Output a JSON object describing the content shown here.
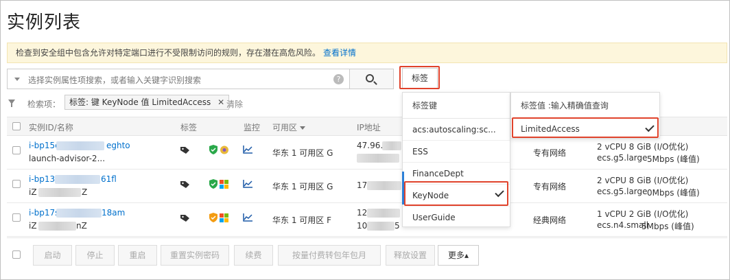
{
  "page": {
    "title": "实例列表",
    "warning_text": "检查到安全组中包含允许对特定端口进行不受限制访问的规则，存在潜在高危风险。",
    "warning_link": "查看详情"
  },
  "search": {
    "placeholder": "选择实例属性项搜索，或者输入关键字识别搜索",
    "help": "?",
    "tag_button": "标签"
  },
  "filter": {
    "label": "检索项：",
    "chip": "标签: 键 KeyNode 值 LimitedAccess",
    "chip_close": "✕",
    "clear": "清除"
  },
  "table": {
    "headers": {
      "id": "实例ID/名称",
      "tags": "标签",
      "monitor": "监控",
      "zone": "可用区",
      "ip": "IP地址"
    },
    "rows": [
      {
        "id_prefix": "i-bp15e",
        "id_suffix": "eghto",
        "name": "launch-advisor-2...",
        "zone": "华东 1 可用区 G",
        "ip": "47.96.",
        "network": "专有网络",
        "spec1": "2 vCPU 8 GiB (I/O优化)",
        "spec2": "ecs.g5.large",
        "bandwidth": "5Mbps (峰值)"
      },
      {
        "id_prefix": "i-bp13l",
        "id_suffix": "61fl",
        "name": "iZ",
        "name_suffix": "Z",
        "zone": "华东 1 可用区 G",
        "ip": "17",
        "network": "专有网络",
        "spec1": "2 vCPU 8 GiB (I/O优化)",
        "spec2": "ecs.g5.large",
        "bandwidth": "0Mbps (峰值)"
      },
      {
        "id_prefix": "i-bp17s",
        "id_suffix": "18am",
        "name": "iZ",
        "name_suffix": "nZ",
        "zone": "华东 1 可用区 F",
        "ip": "12",
        "ip2": "10",
        "ip2_suffix": "5",
        "network": "经典网络",
        "spec1": "1 vCPU 2 GiB (I/O优化)",
        "spec2": "ecs.n4.small",
        "bandwidth": "5Mbps (峰值)"
      }
    ]
  },
  "tag_menu": {
    "key_header": "标签键",
    "keys": [
      "acs:autoscaling:sc...",
      "ESS",
      "FinanceDept",
      "KeyNode",
      "UserGuide"
    ],
    "selected_key": "KeyNode",
    "value_header": "标签值 :输入精确值查询",
    "value": "LimitedAccess"
  },
  "footer": {
    "buttons": [
      "启动",
      "停止",
      "重启",
      "重置实例密码",
      "续费",
      "按量付费转包年包月",
      "释放设置",
      "更多▴"
    ]
  },
  "colors": {
    "link": "#0070cc",
    "highlight_border": "#e0422b",
    "warning_bg": "#fdf6dc"
  }
}
